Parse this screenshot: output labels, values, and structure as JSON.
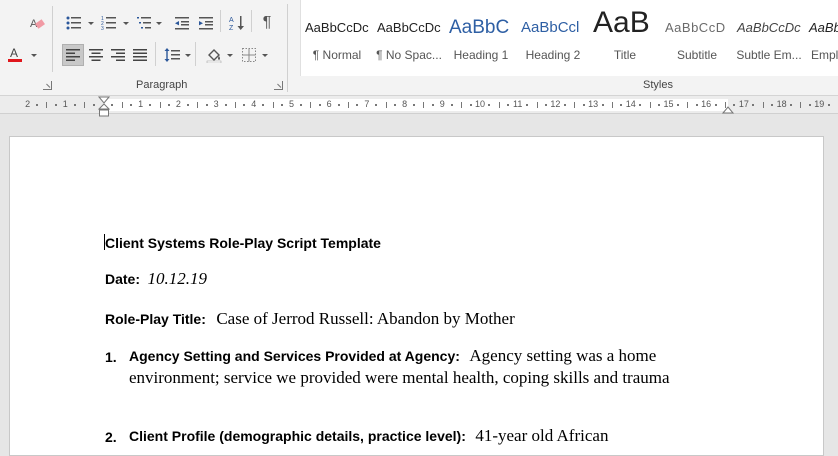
{
  "ribbon": {
    "groups": {
      "paragraph": "Paragraph",
      "styles": "Styles"
    },
    "icons": {
      "clear_format": "eraser-icon",
      "bullets": "bullets-icon",
      "numbering": "numbering-icon",
      "multilevel": "multilevel-list-icon",
      "decrease_indent": "decrease-indent-icon",
      "increase_indent": "increase-indent-icon",
      "sort": "sort-icon",
      "show_marks": "pilcrow-icon",
      "font_color": "font-color-icon",
      "align_left": "align-left-icon",
      "align_center": "align-center-icon",
      "align_right": "align-right-icon",
      "justify": "justify-icon",
      "line_spacing": "line-spacing-icon",
      "shading": "shading-icon",
      "borders": "borders-icon"
    },
    "font_color_hex": "#e0161c",
    "styles": [
      {
        "sample": "AaBbCcDc",
        "name": "¶ Normal"
      },
      {
        "sample": "AaBbCcDc",
        "name": "¶ No Spac..."
      },
      {
        "sample": "AaBbC",
        "name": "Heading 1"
      },
      {
        "sample": "AaBbCcl",
        "name": "Heading 2"
      },
      {
        "sample": "AaB",
        "name": "Title"
      },
      {
        "sample": "AaBbCcD",
        "name": "Subtitle"
      },
      {
        "sample": "AaBbCcDc",
        "name": "Subtle Em..."
      },
      {
        "sample": "AaBb",
        "name": "Empl"
      }
    ]
  },
  "ruler": {
    "left_labels": [
      "2",
      "1"
    ],
    "right_labels": [
      "1",
      "2",
      "3",
      "4",
      "5",
      "6",
      "7",
      "8",
      "9",
      "10",
      "11",
      "12",
      "13",
      "14",
      "15",
      "16",
      "17",
      "18",
      "19"
    ]
  },
  "document": {
    "heading": "Client Systems Role-Play Script Template",
    "date_label": "Date:",
    "date_value": "10.12.19",
    "title_label": "Role-Play Title:",
    "title_value": "Case of Jerrod Russell: Abandon by Mother",
    "item1": {
      "number": "1.",
      "label": "Agency Setting and Services Provided at Agency:",
      "value_line1": "Agency setting was a home",
      "value_line2": "environment; service we provided were mental health, coping skills and trauma"
    },
    "item2": {
      "number": "2.",
      "label": "Client Profile (demographic details, practice level):",
      "value": "41-year old African"
    }
  }
}
